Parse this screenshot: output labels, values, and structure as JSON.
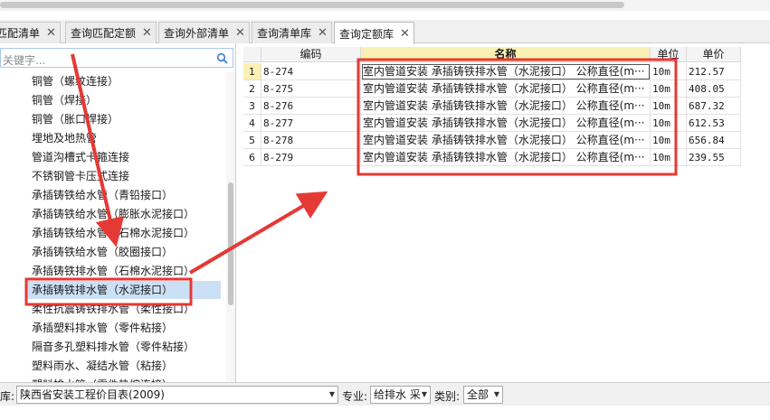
{
  "tabs": [
    {
      "label": "匹配清单",
      "active": false
    },
    {
      "label": "查询匹配定额",
      "active": false
    },
    {
      "label": "查询外部清单",
      "active": false
    },
    {
      "label": "查询清单库",
      "active": false
    },
    {
      "label": "查询定额库",
      "active": true
    }
  ],
  "tab_close": "✕",
  "search": {
    "placeholder": "关键字..."
  },
  "tree": [
    "铜管（螺纹连接）",
    "铜管（焊接）",
    "铜管（胀口焊接）",
    "埋地及地热管",
    "管道沟槽式卡箍连接",
    "不锈钢管卡压式连接",
    "承插铸铁给水管（青铅接口）",
    "承插铸铁给水管（膨胀水泥接口）",
    "承插铸铁给水管（石棉水泥接口）",
    "承插铸铁给水管（胶圈接口）",
    "承插铸铁排水管（石棉水泥接口）",
    "承插铸铁排水管（水泥接口）",
    "柔性抗震铸铁排水管（柔性接口）",
    "承插塑料排水管（零件粘接）",
    "隔音多孔塑料排水管（零件粘接）",
    "塑料雨水、凝结水管（粘接）",
    "塑料排水管（零件热熔连接）"
  ],
  "tree_selected_index": 11,
  "grid": {
    "headers": {
      "code": "编码",
      "name": "名称",
      "unit": "单位",
      "price": "单价"
    },
    "rows": [
      {
        "idx": "1",
        "code": "8-274",
        "name": "室内管道安装 承插铸铁排水管（水泥接口） 公称直径(m···",
        "unit": "10m",
        "price": "212.57"
      },
      {
        "idx": "2",
        "code": "8-275",
        "name": "室内管道安装 承插铸铁排水管（水泥接口） 公称直径(m···",
        "unit": "10m",
        "price": "408.05"
      },
      {
        "idx": "3",
        "code": "8-276",
        "name": "室内管道安装 承插铸铁排水管（水泥接口） 公称直径(m···",
        "unit": "10m",
        "price": "687.32"
      },
      {
        "idx": "4",
        "code": "8-277",
        "name": "室内管道安装 承插铸铁排水管（水泥接口） 公称直径(m···",
        "unit": "10m",
        "price": "612.53"
      },
      {
        "idx": "5",
        "code": "8-278",
        "name": "室内管道安装 承插铸铁排水管（水泥接口） 公称直径(m···",
        "unit": "10m",
        "price": "656.84"
      },
      {
        "idx": "6",
        "code": "8-279",
        "name": "室内管道安装 承插铸铁排水管（水泥接口） 公称直径(m···",
        "unit": "10m",
        "price": "239.55"
      }
    ]
  },
  "bottom": {
    "lib_label": "库:",
    "lib_value": "陕西省安装工程价目表(2009)",
    "major_label": "专业:",
    "major_value": "给排水 采",
    "category_label": "类别:",
    "category_value": "全部"
  },
  "colors": {
    "annotation": "#e53935",
    "selected": "#cce0f5",
    "header_highlight": "#fbf0b4"
  }
}
